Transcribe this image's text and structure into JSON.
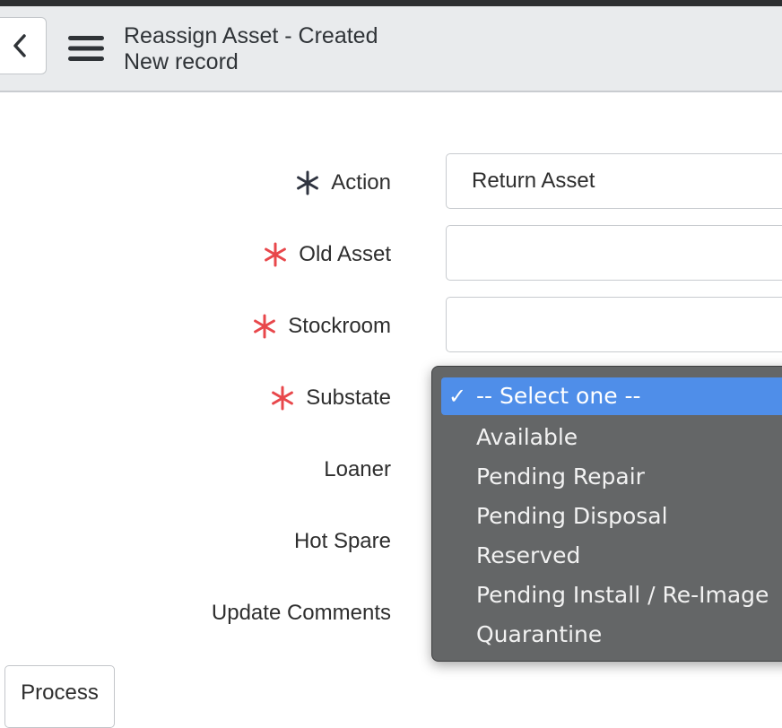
{
  "header": {
    "title": "Reassign Asset - Created",
    "subtitle": "New record",
    "back_icon": "chevron-left-icon",
    "menu_icon": "hamburger-menu-icon"
  },
  "form": {
    "required_color_filled": "#2f3440",
    "required_color_empty": "#e8474b",
    "fields": {
      "action": {
        "label": "Action",
        "value": "Return Asset",
        "required": true
      },
      "old_asset": {
        "label": "Old Asset",
        "value": "",
        "required": true
      },
      "stockroom": {
        "label": "Stockroom",
        "value": "",
        "required": true
      },
      "substate": {
        "label": "Substate",
        "required": true
      },
      "loaner": {
        "label": "Loaner"
      },
      "hot_spare": {
        "label": "Hot Spare"
      },
      "update_comments": {
        "label": "Update Comments"
      }
    }
  },
  "substate_dropdown": {
    "selected": "-- Select one --",
    "check_glyph": "✓",
    "highlight_color": "#4f8ee9",
    "options": [
      "-- Select one --",
      "Available",
      "Pending Repair",
      "Pending Disposal",
      "Reserved",
      "Pending Install / Re-Image",
      "Quarantine"
    ]
  },
  "footer": {
    "process_label": "Process"
  }
}
